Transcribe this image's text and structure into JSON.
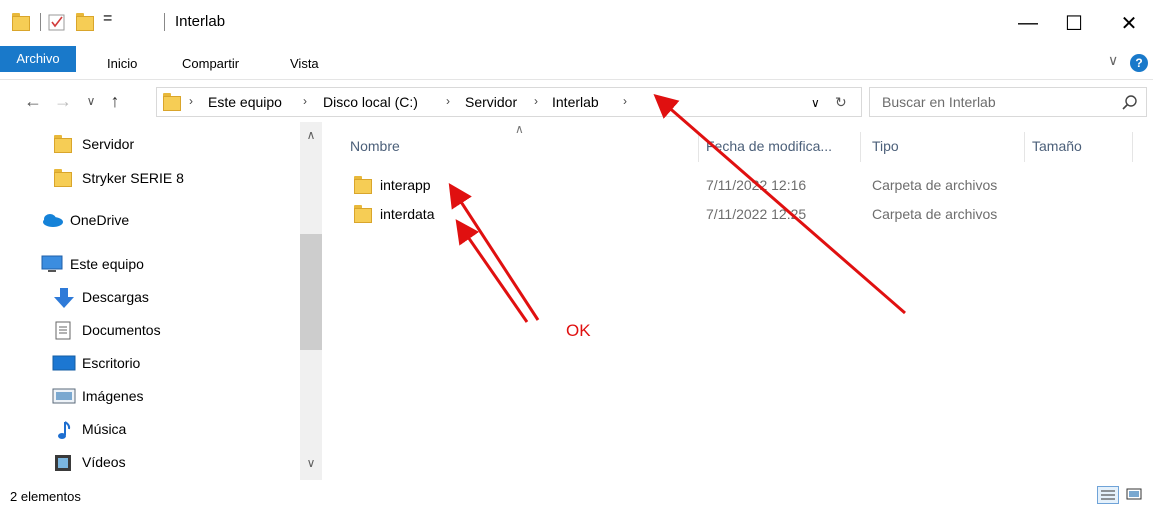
{
  "window": {
    "title": "Interlab",
    "qa_dropdown": "=",
    "minimize": "—",
    "maximize": "☐",
    "close": "✕"
  },
  "ribbon": {
    "tabs": [
      "Archivo",
      "Inicio",
      "Compartir",
      "Vista"
    ],
    "help": "?",
    "collapse": "∨"
  },
  "address": {
    "back": "←",
    "forward": "→",
    "recent": "∨",
    "up": "↑",
    "breadcrumbs": [
      "Este equipo",
      "Disco local (C:)",
      "Servidor",
      "Interlab"
    ],
    "dropdown": "∨",
    "refresh": "↻"
  },
  "search": {
    "placeholder": "Buscar en Interlab"
  },
  "nav": {
    "items": [
      {
        "label": "Servidor",
        "icon": "folder-icon"
      },
      {
        "label": "Stryker SERIE 8",
        "icon": "folder-icon"
      },
      {
        "label": "OneDrive",
        "icon": "onedrive-icon"
      },
      {
        "label": "Este equipo",
        "icon": "computer-icon"
      },
      {
        "label": "Descargas",
        "icon": "download-icon"
      },
      {
        "label": "Documentos",
        "icon": "documents-icon"
      },
      {
        "label": "Escritorio",
        "icon": "desktop-icon"
      },
      {
        "label": "Imágenes",
        "icon": "pictures-icon"
      },
      {
        "label": "Música",
        "icon": "music-icon"
      },
      {
        "label": "Vídeos",
        "icon": "videos-icon"
      }
    ],
    "scroll_up": "∧",
    "scroll_down": "∨"
  },
  "filelist": {
    "columns": [
      "Nombre",
      "Fecha de modifica...",
      "Tipo",
      "Tamaño"
    ],
    "sort_indicator": "∧",
    "rows": [
      {
        "name": "interapp",
        "date": "7/11/2022 12:16",
        "type": "Carpeta de archivos"
      },
      {
        "name": "interdata",
        "date": "7/11/2022 12:25",
        "type": "Carpeta de archivos"
      }
    ]
  },
  "status": {
    "count": "2 elementos"
  },
  "annotation": {
    "text": "OK",
    "color": "#e01010"
  },
  "colors": {
    "accent": "#1979ca",
    "folder": "#f6cd55"
  }
}
